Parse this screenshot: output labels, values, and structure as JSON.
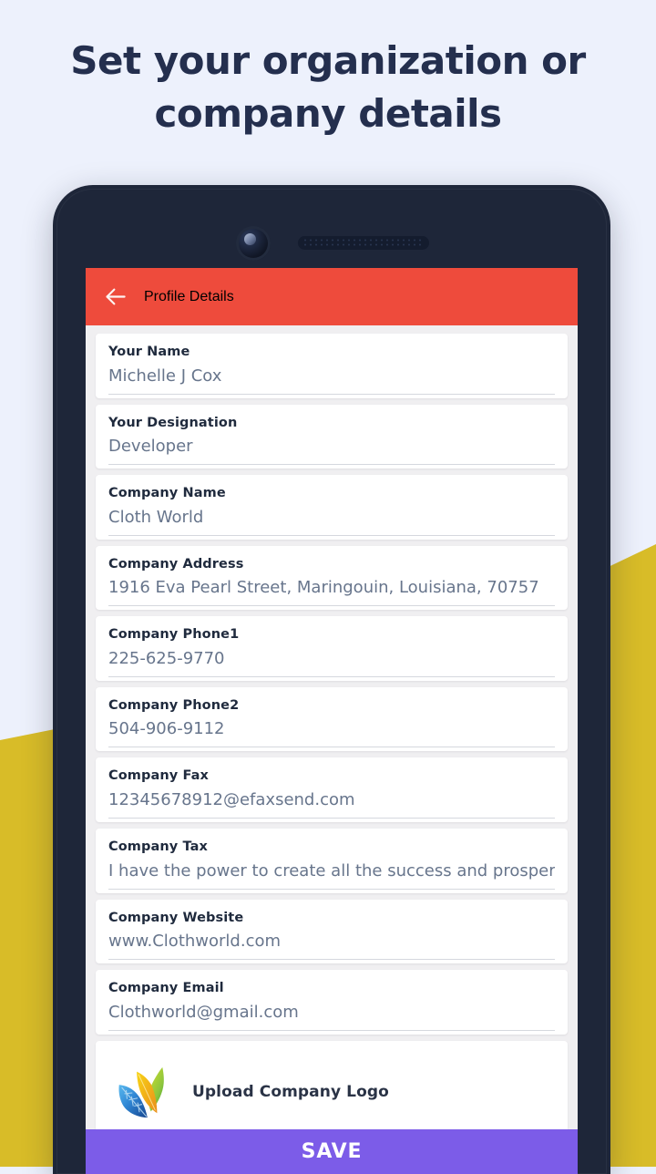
{
  "headline": "Set your organization or company details",
  "colors": {
    "page_background": "#EDF1FC",
    "accent_yellow": "#D8BC28",
    "phone_bezel": "#1E2639",
    "appbar_red": "#EE4B3C",
    "save_purple": "#7C5CE8",
    "screen_background": "#F0EFF1",
    "label_text": "#1F2A3D",
    "value_text": "#67758C"
  },
  "appbar": {
    "back_icon": "arrow-left-icon",
    "title": "Profile Details"
  },
  "form": {
    "fields": [
      {
        "label": "Your Name",
        "value": "Michelle J Cox"
      },
      {
        "label": "Your Designation",
        "value": "Developer"
      },
      {
        "label": "Company Name",
        "value": "Cloth World"
      },
      {
        "label": "Company Address",
        "value": "1916  Eva Pearl Street, Maringouin, Louisiana, 70757"
      },
      {
        "label": "Company Phone1",
        "value": "225-625-9770"
      },
      {
        "label": "Company Phone2",
        "value": "504-906-9112"
      },
      {
        "label": "Company Fax",
        "value": "12345678912@efaxsend.com"
      },
      {
        "label": "Company Tax",
        "value": "I have the power to create all the success and prosperity"
      },
      {
        "label": "Company Website",
        "value": "www.Clothworld.com"
      },
      {
        "label": "Company Email",
        "value": "Clothworld@gmail.com"
      }
    ]
  },
  "logo_upload": {
    "icon": "leaf-logo-icon",
    "label": "Upload Company Logo"
  },
  "save": {
    "label": "SAVE"
  }
}
